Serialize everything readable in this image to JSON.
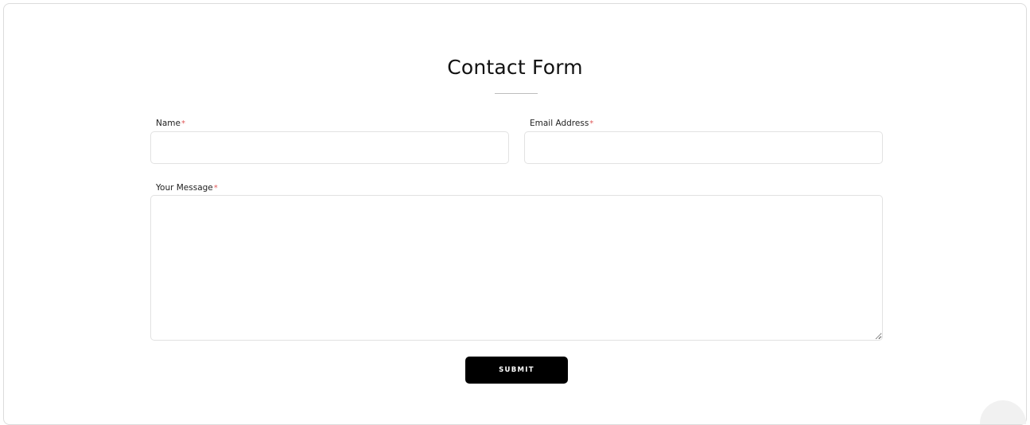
{
  "form": {
    "title": "Contact Form",
    "required_marker": "*",
    "fields": {
      "name": {
        "label": "Name",
        "value": "",
        "placeholder": ""
      },
      "email": {
        "label": "Email Address",
        "value": "",
        "placeholder": ""
      },
      "message": {
        "label": "Your Message",
        "value": "",
        "placeholder": ""
      }
    },
    "submit_label": "SUBMIT"
  },
  "colors": {
    "required": "#e05a5a",
    "button_bg": "#000000",
    "button_text": "#ffffff",
    "border": "#e2e2e2"
  }
}
